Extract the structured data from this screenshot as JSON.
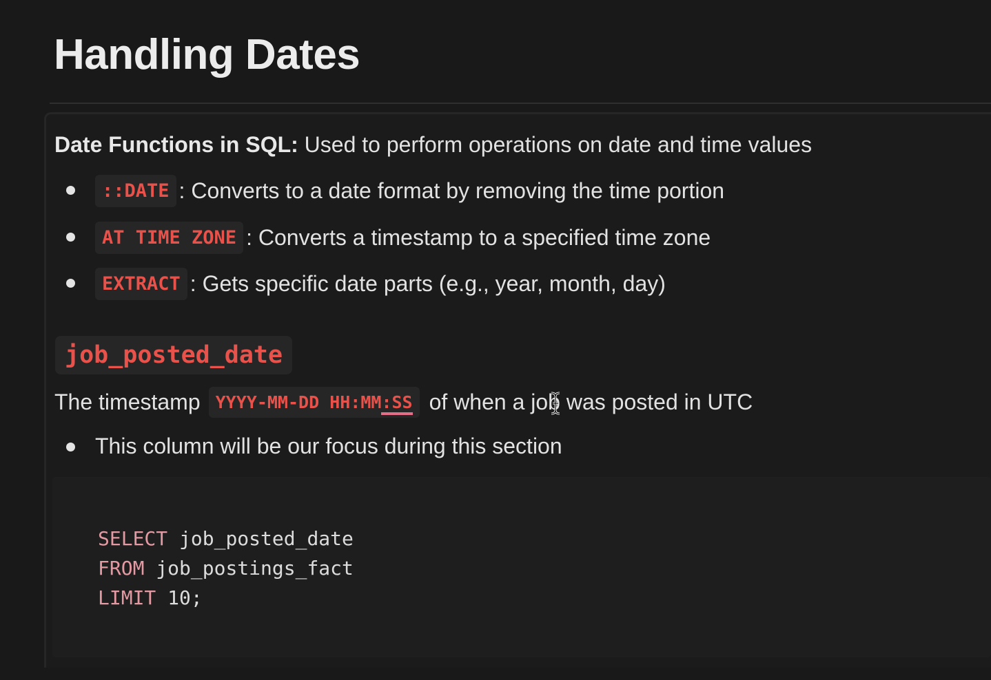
{
  "page": {
    "title": "Handling Dates"
  },
  "intro": {
    "bold": "Date Functions in SQL:",
    "text": " Used to perform operations on date and time values"
  },
  "functions": [
    {
      "code": "::DATE",
      "text": ": Converts to a date format by removing the time portion"
    },
    {
      "code": "AT TIME ZONE",
      "text": ": Converts a timestamp to a specified time zone"
    },
    {
      "code": "EXTRACT",
      "text": ": Gets specific date parts (e.g., year, month, day)"
    }
  ],
  "column": {
    "name": "job_posted_date",
    "desc_before": "The timestamp",
    "format_main": "YYYY-MM-DD HH:MM",
    "format_underlined": ":SS",
    "desc_after": "of when a job was posted in UTC",
    "bullet": "This column will be our focus during this section"
  },
  "code": {
    "lines": [
      {
        "kw": "SELECT",
        "rest": " job_posted_date"
      },
      {
        "kw": "FROM",
        "rest": " job_postings_fact"
      },
      {
        "kw": "LIMIT",
        "rest": " 10;"
      }
    ]
  },
  "colors": {
    "background": "#191919",
    "inline_code": "#e8524a",
    "keyword": "#e39aa3",
    "underline": "#e36e88"
  },
  "icons": {
    "cursor": "text-cursor-icon"
  }
}
